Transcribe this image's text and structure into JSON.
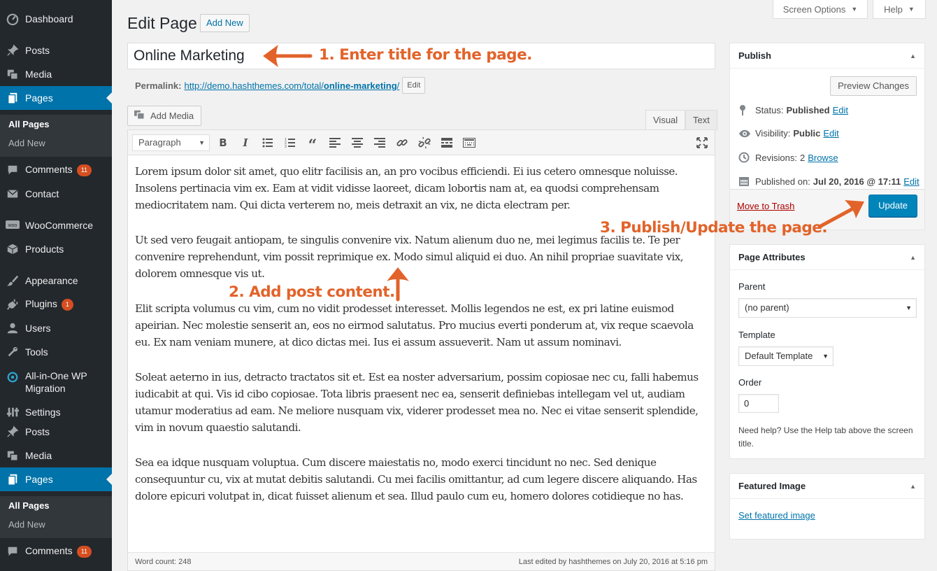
{
  "sidebar": {
    "items": [
      {
        "label": "Dashboard",
        "icon": "dashboard-icon"
      },
      {
        "label": "Posts",
        "icon": "pin-icon"
      },
      {
        "label": "Media",
        "icon": "media-icon"
      },
      {
        "label": "Pages",
        "icon": "pages-icon"
      },
      {
        "label": "Comments",
        "icon": "comment-icon",
        "badge": "11"
      },
      {
        "label": "Contact",
        "icon": "mail-icon"
      },
      {
        "label": "WooCommerce",
        "icon": "woo-icon"
      },
      {
        "label": "Products",
        "icon": "box-icon"
      },
      {
        "label": "Appearance",
        "icon": "brush-icon"
      },
      {
        "label": "Plugins",
        "icon": "plug-icon",
        "badge": "1"
      },
      {
        "label": "Users",
        "icon": "user-icon"
      },
      {
        "label": "Tools",
        "icon": "wrench-icon"
      },
      {
        "label": "All-in-One WP Migration",
        "icon": "migration-icon"
      },
      {
        "label": "Settings",
        "icon": "settings-icon"
      },
      {
        "label": "Posts",
        "icon": "pin-icon"
      },
      {
        "label": "Media",
        "icon": "media-icon"
      },
      {
        "label": "Pages",
        "icon": "pages-icon"
      },
      {
        "label": "Comments",
        "icon": "comment-icon",
        "badge": "11"
      }
    ],
    "submenu": {
      "all_pages": "All Pages",
      "add_new": "Add New"
    }
  },
  "top": {
    "screen_options": "Screen Options",
    "help": "Help"
  },
  "header": {
    "title": "Edit Page",
    "add_new": "Add New"
  },
  "post": {
    "title": "Online Marketing",
    "permalink_label": "Permalink:",
    "permalink_base": "http://demo.hashthemes.com/total/",
    "permalink_slug": "online-marketing",
    "permalink_end": "/",
    "edit_label": "Edit"
  },
  "editor": {
    "add_media": "Add Media",
    "tab_visual": "Visual",
    "tab_text": "Text",
    "format": "Paragraph",
    "paragraphs": [
      "Lorem ipsum dolor sit amet, quo elitr facilisis an, an pro vocibus efficiendi. Ei ius cetero omnesque noluisse. Insolens pertinacia vim ex. Eam at vidit vidisse laoreet, dicam lobortis nam at, ea quodsi comprehensam mediocritatem nam. Qui dicta verterem no, meis detraxit an vix, ne dicta electram per.",
      "Ut sed vero feugait antiopam, te singulis convenire vix. Natum alienum duo ne, mei legimus facilis te. Te per convenire reprehendunt, vim possit reprimique ex. Modo simul aliquid ei duo. An nihil propriae suavitate vix, dolorem omnesque vis ut.",
      "Elit scripta volumus cu vim, cum no vidit prodesset interesset. Mollis legendos ne est, ex pri latine euismod apeirian. Nec molestie senserit an, eos no eirmod salutatus. Pro mucius everti ponderum at, vix reque scaevola eu. Ex nam veniam munere, at dico dictas mei. Ius ei assum assueverit. Nam ut assum nominavi.",
      "Soleat aeterno in ius, detracto tractatos sit et. Est ea noster adversarium, possim copiosae nec cu, falli habemus iudicabit at qui. Vis id cibo copiosae. Tota libris praesent nec ea, senserit definiebas intellegam vel ut, audiam utamur moderatius ad eam. Ne meliore nusquam vix, viderer prodesset mea no. Nec ei vitae senserit splendide, vim in novum quaestio salutandi.",
      "Sea ea idque nusquam voluptua. Cum discere maiestatis no, modo exerci tincidunt no nec. Sed denique consequuntur cu, vix at mutat debitis salutandi. Cu mei facilis omittantur, ad cum legere discere aliquando. Has dolore epicuri volutpat in, dicat fuisset alienum et sea. Illud paulo cum eu, homero dolores cotidieque no has."
    ],
    "word_count": "Word count: 248",
    "last_edited": "Last edited by hashthemes on July 20, 2016 at 5:16 pm"
  },
  "publish": {
    "title": "Publish",
    "preview": "Preview Changes",
    "status_label": "Status:",
    "status_value": "Published",
    "visibility_label": "Visibility:",
    "visibility_value": "Public",
    "revisions_label": "Revisions:",
    "revisions_value": "2",
    "revisions_link": "Browse",
    "published_label": "Published on:",
    "published_value": "Jul 20, 2016 @ 17:11",
    "edit": "Edit",
    "trash": "Move to Trash",
    "update": "Update"
  },
  "attributes": {
    "title": "Page Attributes",
    "parent_label": "Parent",
    "parent_value": "(no parent)",
    "template_label": "Template",
    "template_value": "Default Template",
    "order_label": "Order",
    "order_value": "0",
    "help": "Need help? Use the Help tab above the screen title."
  },
  "featured": {
    "title": "Featured Image",
    "link": "Set featured image"
  },
  "annotations": {
    "step1": "1. Enter title for the page.",
    "step2": "2. Add post content.",
    "step3": "3. Publish/Update the page.",
    "color": "#e2632a"
  },
  "colors": {
    "sidebar": "#23282d",
    "active": "#0073aa",
    "link": "#0073aa",
    "primary_button": "#0085ba",
    "badge": "#d54e21"
  }
}
